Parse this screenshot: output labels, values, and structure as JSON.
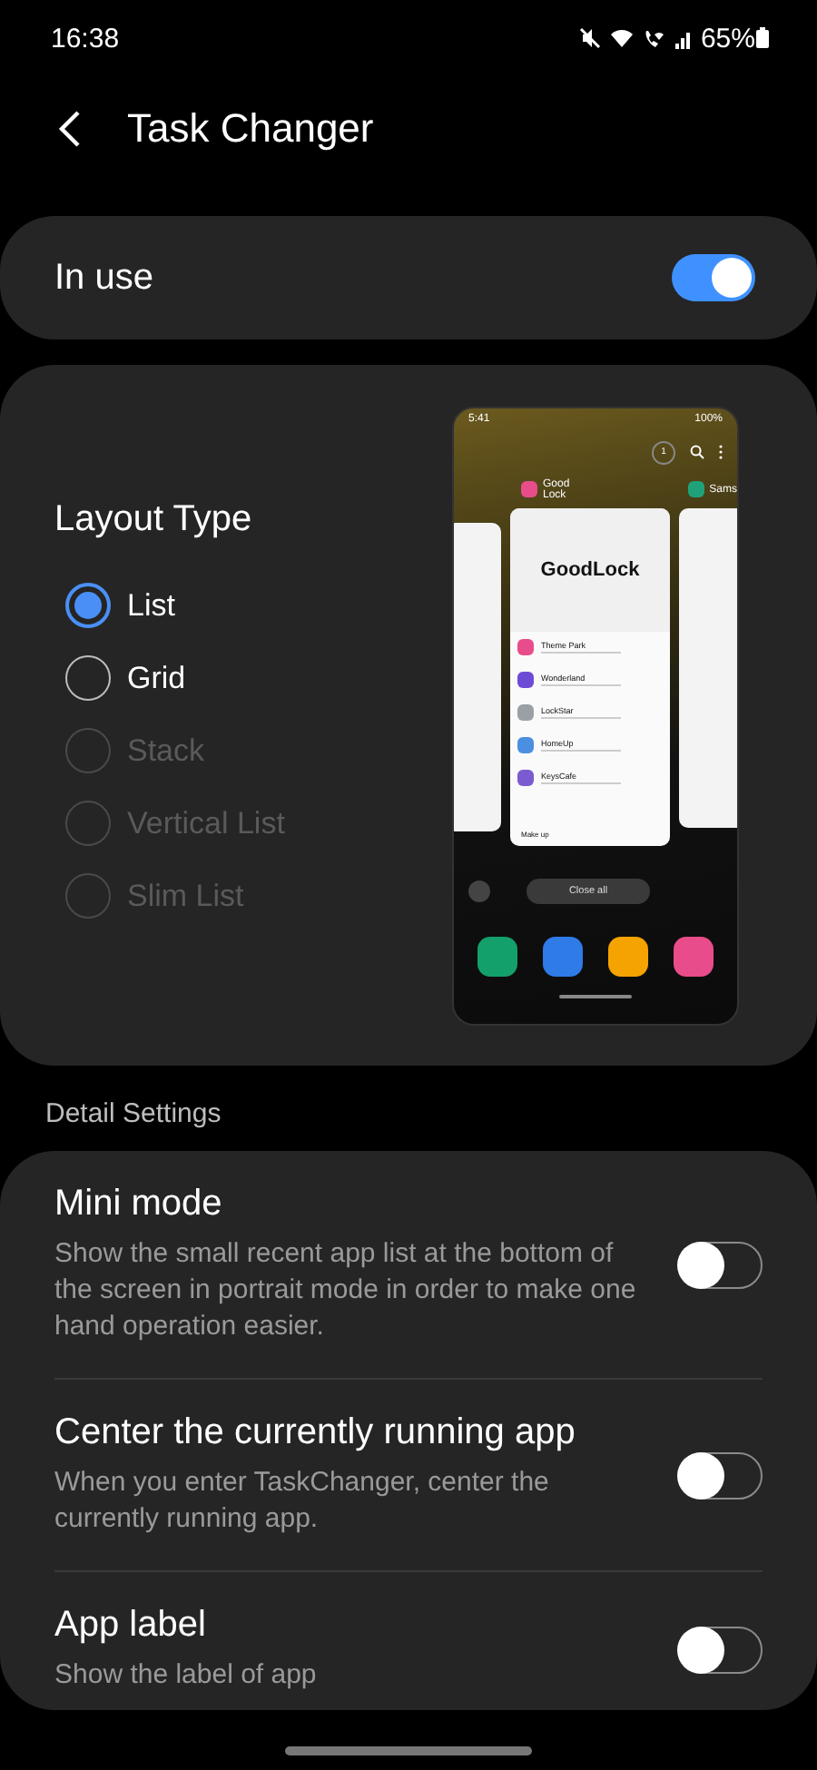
{
  "status_bar": {
    "time": "16:38",
    "battery": "65%"
  },
  "header": {
    "title": "Task Changer"
  },
  "in_use": {
    "label": "In use",
    "on": true
  },
  "layout": {
    "title": "Layout Type",
    "options": [
      {
        "label": "List",
        "selected": true,
        "disabled": false
      },
      {
        "label": "Grid",
        "selected": false,
        "disabled": false
      },
      {
        "label": "Stack",
        "selected": false,
        "disabled": true
      },
      {
        "label": "Vertical List",
        "selected": false,
        "disabled": true
      },
      {
        "label": "Slim List",
        "selected": false,
        "disabled": true
      }
    ]
  },
  "preview": {
    "time": "5:41",
    "battery": "100%",
    "badge": "1",
    "app_name": "Good Lock",
    "next_app_name": "Sams",
    "logo": "GoodLock",
    "items": [
      {
        "name": "Theme Park"
      },
      {
        "name": "Wonderland"
      },
      {
        "name": "LockStar"
      },
      {
        "name": "HomeUp"
      },
      {
        "name": "KeysCafe"
      }
    ],
    "footer": "Make up",
    "close_all": "Close all"
  },
  "section_header": "Detail Settings",
  "settings": [
    {
      "title": "Mini mode",
      "description": "Show the small recent app list at the bottom of the screen in portrait mode in order to make one hand operation easier.",
      "on": false
    },
    {
      "title": "Center the currently running app",
      "description": "When you enter TaskChanger, center the currently running app.",
      "on": false
    },
    {
      "title": "App label",
      "description": "Show the label of app",
      "on": false
    }
  ]
}
